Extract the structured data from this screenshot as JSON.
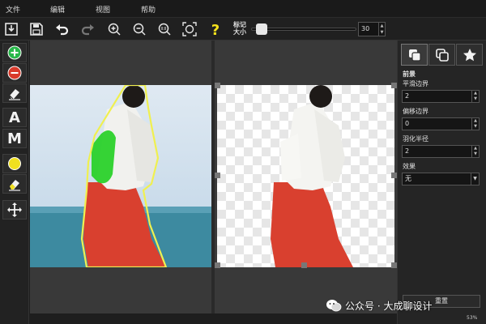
{
  "menu": {
    "items": [
      "文件",
      "编辑",
      "视图",
      "帮助"
    ]
  },
  "toolbar": {
    "mark_size_label": "标记大小",
    "mark_size_value": "30",
    "slider_fraction": 0.05
  },
  "tools": {
    "text_a": "A",
    "text_m": "M"
  },
  "panel": {
    "section_title": "前景",
    "smooth_label": "平滑边界",
    "smooth_value": "2",
    "offset_label": "偏移边界",
    "offset_value": "0",
    "feather_label": "羽化半径",
    "feather_value": "2",
    "effect_label": "效果",
    "effect_value": "无",
    "reset_label": "重置"
  },
  "status": {
    "zoom": "53%"
  },
  "watermark": {
    "text": "公众号 · 大成聊设计"
  },
  "colors": {
    "accent_green": "#29b84a",
    "accent_red": "#d93a2b",
    "help_yellow": "#f5e21c",
    "selection_green": "#2ad12a",
    "outline_yellow": "#f0f050"
  }
}
